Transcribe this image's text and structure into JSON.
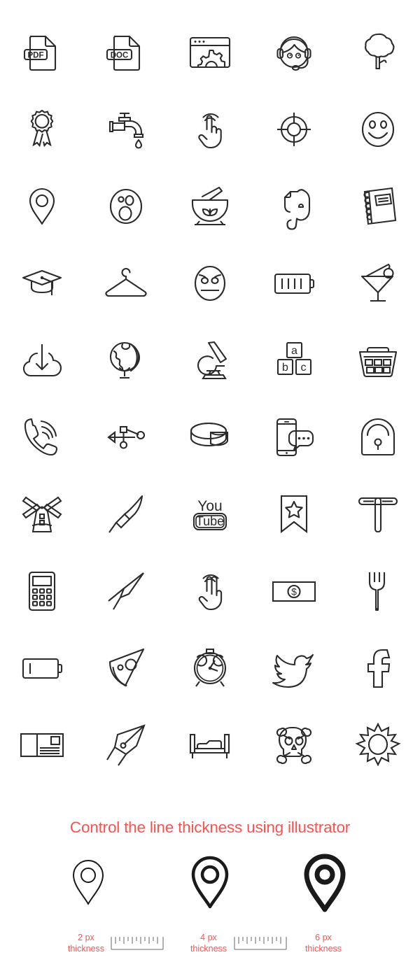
{
  "sheet": {
    "background_color": "#ffffff",
    "icon_stroke_color": "#2b2b2b",
    "accent_color": "#fb524f",
    "columns": 5,
    "rows": 10
  },
  "icons": [
    {
      "name": "pdf-file-icon",
      "label": "PDF file",
      "text": "PDF"
    },
    {
      "name": "doc-file-icon",
      "label": "DOC file",
      "text": "DOC"
    },
    {
      "name": "browser-settings-icon",
      "label": "Browser settings",
      "text": ""
    },
    {
      "name": "support-agent-icon",
      "label": "Support headset",
      "text": ""
    },
    {
      "name": "tree-icon",
      "label": "Tree",
      "text": ""
    },
    {
      "name": "award-ribbon-icon",
      "label": "Award ribbon",
      "text": ""
    },
    {
      "name": "faucet-icon",
      "label": "Faucet with drop",
      "text": ""
    },
    {
      "name": "tap-gesture-icon",
      "label": "One finger tap",
      "text": ""
    },
    {
      "name": "crosshair-target-icon",
      "label": "Crosshair target",
      "text": ""
    },
    {
      "name": "smiley-face-icon",
      "label": "Smiley face",
      "text": ""
    },
    {
      "name": "map-pin-icon",
      "label": "Map pin",
      "text": ""
    },
    {
      "name": "surprised-face-icon",
      "label": "Surprised face",
      "text": ""
    },
    {
      "name": "mortar-pestle-icon",
      "label": "Mortar and pestle",
      "text": ""
    },
    {
      "name": "evernote-elephant-icon",
      "label": "Evernote elephant",
      "text": ""
    },
    {
      "name": "spiral-notebook-icon",
      "label": "Spiral notebook",
      "text": ""
    },
    {
      "name": "graduation-cap-icon",
      "label": "Graduation cap",
      "text": ""
    },
    {
      "name": "clothes-hanger-icon",
      "label": "Clothes hanger",
      "text": ""
    },
    {
      "name": "angry-face-icon",
      "label": "Angry face",
      "text": ""
    },
    {
      "name": "battery-full-icon",
      "label": "Battery full",
      "text": ""
    },
    {
      "name": "cocktail-glass-icon",
      "label": "Cocktail glass",
      "text": ""
    },
    {
      "name": "cloud-download-icon",
      "label": "Cloud download",
      "text": ""
    },
    {
      "name": "globe-stand-icon",
      "label": "Globe on stand",
      "text": ""
    },
    {
      "name": "microscope-icon",
      "label": "Microscope",
      "text": ""
    },
    {
      "name": "abc-blocks-icon",
      "label": "ABC blocks",
      "text": "a b c"
    },
    {
      "name": "shopping-basket-icon",
      "label": "Shopping basket",
      "text": ""
    },
    {
      "name": "phone-ringing-icon",
      "label": "Phone ringing",
      "text": ""
    },
    {
      "name": "usb-icon",
      "label": "USB",
      "text": ""
    },
    {
      "name": "pie-chart-3d-icon",
      "label": "3D pie chart",
      "text": ""
    },
    {
      "name": "phone-chat-icon",
      "label": "Phone chat bubble",
      "text": ""
    },
    {
      "name": "padlock-icon",
      "label": "Padlock",
      "text": ""
    },
    {
      "name": "windmill-icon",
      "label": "Windmill",
      "text": ""
    },
    {
      "name": "paintbrush-icon",
      "label": "Paintbrush",
      "text": ""
    },
    {
      "name": "youtube-icon",
      "label": "YouTube logo",
      "text": "You Tube"
    },
    {
      "name": "bookmark-star-icon",
      "label": "Bookmark with star",
      "text": ""
    },
    {
      "name": "t-square-icon",
      "label": "T-square ruler",
      "text": ""
    },
    {
      "name": "calculator-icon",
      "label": "Calculator",
      "text": ""
    },
    {
      "name": "pencil-icon",
      "label": "Pencil",
      "text": ""
    },
    {
      "name": "two-finger-tap-icon",
      "label": "Two finger tap",
      "text": ""
    },
    {
      "name": "banknote-icon",
      "label": "Dollar banknote",
      "text": "$"
    },
    {
      "name": "fork-icon",
      "label": "Fork",
      "text": ""
    },
    {
      "name": "battery-low-icon",
      "label": "Battery low",
      "text": ""
    },
    {
      "name": "pizza-slice-icon",
      "label": "Pizza slice",
      "text": ""
    },
    {
      "name": "alarm-clock-icon",
      "label": "Alarm clock",
      "text": ""
    },
    {
      "name": "twitter-bird-icon",
      "label": "Twitter bird",
      "text": ""
    },
    {
      "name": "facebook-icon",
      "label": "Facebook f",
      "text": "f"
    },
    {
      "name": "postcard-icon",
      "label": "Postcard",
      "text": ""
    },
    {
      "name": "fountain-pen-nib-icon",
      "label": "Fountain pen nib",
      "text": ""
    },
    {
      "name": "bed-icon",
      "label": "Bed",
      "text": ""
    },
    {
      "name": "skull-crossbones-icon",
      "label": "Skull and crossbones",
      "text": ""
    },
    {
      "name": "sun-icon",
      "label": "Sun",
      "text": ""
    }
  ],
  "footer": {
    "title": "Control the line thickness using illustrator",
    "samples": [
      {
        "stroke_px": 2,
        "line1": "2 px",
        "line2": "thickness"
      },
      {
        "stroke_px": 4,
        "line1": "4 px",
        "line2": "thickness"
      },
      {
        "stroke_px": 6,
        "line1": "6 px",
        "line2": "thickness"
      }
    ],
    "ruler_count": 2
  }
}
